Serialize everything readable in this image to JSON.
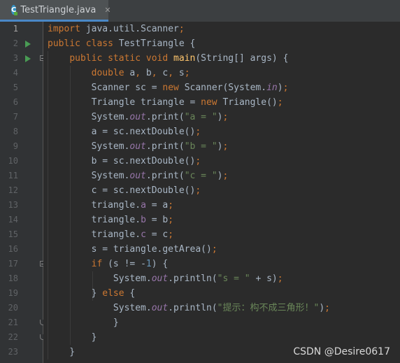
{
  "tab": {
    "label": "TestTriangle.java",
    "icon": "class-c-icon",
    "icon_letter": "C",
    "close": "✕"
  },
  "active_line": 1,
  "lines": [
    {
      "n": "1",
      "run": false,
      "fold": "",
      "parts": [
        [
          "kw",
          "import "
        ],
        [
          "pl",
          "java.util.Scanner"
        ],
        [
          "kw",
          ";"
        ]
      ]
    },
    {
      "n": "2",
      "run": true,
      "fold": "",
      "parts": [
        [
          "kw",
          "public class "
        ],
        [
          "pl",
          "TestTriangle {"
        ]
      ]
    },
    {
      "n": "3",
      "run": true,
      "fold": "start",
      "parts": [
        [
          "pl",
          "    "
        ],
        [
          "kw",
          "public static void "
        ],
        [
          "fn",
          "main"
        ],
        [
          "pl",
          "(String[] args) {"
        ]
      ]
    },
    {
      "n": "4",
      "run": false,
      "fold": "",
      "parts": [
        [
          "pl",
          "        "
        ],
        [
          "kw",
          "double "
        ],
        [
          "pl",
          "a"
        ],
        [
          "kw",
          ", "
        ],
        [
          "pl",
          "b"
        ],
        [
          "kw",
          ", "
        ],
        [
          "pl",
          "c"
        ],
        [
          "kw",
          ", "
        ],
        [
          "pl",
          "s"
        ],
        [
          "kw",
          ";"
        ]
      ]
    },
    {
      "n": "5",
      "run": false,
      "fold": "",
      "parts": [
        [
          "pl",
          "        Scanner sc = "
        ],
        [
          "kw",
          "new "
        ],
        [
          "pl",
          "Scanner(System."
        ],
        [
          "sfld",
          "in"
        ],
        [
          "pl",
          ")"
        ],
        [
          "kw",
          ";"
        ]
      ]
    },
    {
      "n": "6",
      "run": false,
      "fold": "",
      "parts": [
        [
          "pl",
          "        Triangle triangle = "
        ],
        [
          "kw",
          "new "
        ],
        [
          "pl",
          "Triangle()"
        ],
        [
          "kw",
          ";"
        ]
      ]
    },
    {
      "n": "7",
      "run": false,
      "fold": "",
      "parts": [
        [
          "pl",
          "        System."
        ],
        [
          "sfld",
          "out"
        ],
        [
          "pl",
          ".print("
        ],
        [
          "str",
          "\"a = \""
        ],
        [
          "pl",
          ")"
        ],
        [
          "kw",
          ";"
        ]
      ]
    },
    {
      "n": "8",
      "run": false,
      "fold": "",
      "parts": [
        [
          "pl",
          "        a = sc.nextDouble()"
        ],
        [
          "kw",
          ";"
        ]
      ]
    },
    {
      "n": "9",
      "run": false,
      "fold": "",
      "parts": [
        [
          "pl",
          "        System."
        ],
        [
          "sfld",
          "out"
        ],
        [
          "pl",
          ".print("
        ],
        [
          "str",
          "\"b = \""
        ],
        [
          "pl",
          ")"
        ],
        [
          "kw",
          ";"
        ]
      ]
    },
    {
      "n": "10",
      "run": false,
      "fold": "",
      "parts": [
        [
          "pl",
          "        b = sc.nextDouble()"
        ],
        [
          "kw",
          ";"
        ]
      ]
    },
    {
      "n": "11",
      "run": false,
      "fold": "",
      "parts": [
        [
          "pl",
          "        System."
        ],
        [
          "sfld",
          "out"
        ],
        [
          "pl",
          ".print("
        ],
        [
          "str",
          "\"c = \""
        ],
        [
          "pl",
          ")"
        ],
        [
          "kw",
          ";"
        ]
      ]
    },
    {
      "n": "12",
      "run": false,
      "fold": "",
      "parts": [
        [
          "pl",
          "        c = sc.nextDouble()"
        ],
        [
          "kw",
          ";"
        ]
      ]
    },
    {
      "n": "13",
      "run": false,
      "fold": "",
      "parts": [
        [
          "pl",
          "        triangle."
        ],
        [
          "fld",
          "a"
        ],
        [
          "pl",
          " = a"
        ],
        [
          "kw",
          ";"
        ]
      ]
    },
    {
      "n": "14",
      "run": false,
      "fold": "",
      "parts": [
        [
          "pl",
          "        triangle."
        ],
        [
          "fld",
          "b"
        ],
        [
          "pl",
          " = b"
        ],
        [
          "kw",
          ";"
        ]
      ]
    },
    {
      "n": "15",
      "run": false,
      "fold": "",
      "parts": [
        [
          "pl",
          "        triangle."
        ],
        [
          "fld",
          "c"
        ],
        [
          "pl",
          " = c"
        ],
        [
          "kw",
          ";"
        ]
      ]
    },
    {
      "n": "16",
      "run": false,
      "fold": "",
      "parts": [
        [
          "pl",
          "        s = triangle.getArea()"
        ],
        [
          "kw",
          ";"
        ]
      ]
    },
    {
      "n": "17",
      "run": false,
      "fold": "start",
      "parts": [
        [
          "pl",
          "        "
        ],
        [
          "kw",
          "if "
        ],
        [
          "pl",
          "(s != -"
        ],
        [
          "num",
          "1"
        ],
        [
          "pl",
          ") {"
        ]
      ]
    },
    {
      "n": "18",
      "run": false,
      "fold": "",
      "parts": [
        [
          "pl",
          "            System."
        ],
        [
          "sfld",
          "out"
        ],
        [
          "pl",
          ".println("
        ],
        [
          "str",
          "\"s = \" "
        ],
        [
          "pl",
          "+ s)"
        ],
        [
          "kw",
          ";"
        ]
      ]
    },
    {
      "n": "19",
      "run": false,
      "fold": "",
      "parts": [
        [
          "pl",
          "        } "
        ],
        [
          "kw",
          "else "
        ],
        [
          "pl",
          "{"
        ]
      ]
    },
    {
      "n": "20",
      "run": false,
      "fold": "",
      "parts": [
        [
          "pl",
          "            System."
        ],
        [
          "sfld",
          "out"
        ],
        [
          "pl",
          ".println("
        ],
        [
          "str",
          "\"提示：构不成三角形！\""
        ],
        [
          "pl",
          ")"
        ],
        [
          "kw",
          ";"
        ]
      ]
    },
    {
      "n": "21",
      "run": false,
      "fold": "end",
      "parts": [
        [
          "pl",
          "            }"
        ]
      ]
    },
    {
      "n": "22",
      "run": false,
      "fold": "end",
      "parts": [
        [
          "pl",
          "        }"
        ]
      ]
    },
    {
      "n": "23",
      "run": false,
      "fold": "",
      "parts": [
        [
          "pl",
          "    }"
        ]
      ]
    }
  ],
  "watermark": "CSDN @Desire0617"
}
